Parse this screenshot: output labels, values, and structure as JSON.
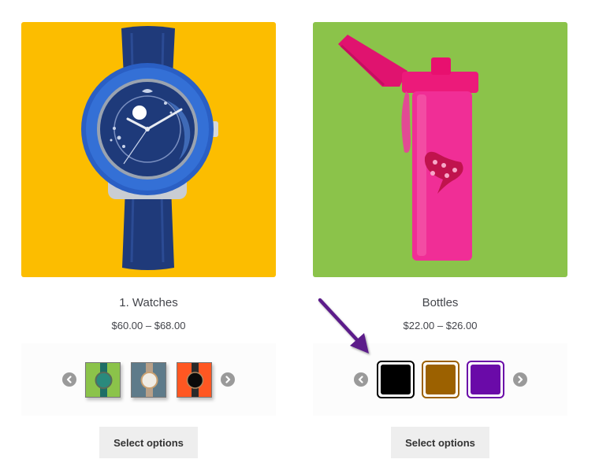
{
  "products": [
    {
      "title": "1. Watches",
      "price": "$60.00 – $68.00",
      "image": {
        "subject": "blue-watch-on-yellow",
        "background": "#fcbd00"
      },
      "swatch_type": "image",
      "swatches": [
        {
          "label": "green-watch",
          "background": "#8bc34a",
          "strap": "#1e6e66",
          "face": "#2a8a7d"
        },
        {
          "label": "silver-gold-watch",
          "background": "#5e7b8a",
          "strap": "#c0a080",
          "face": "#f0ece4"
        },
        {
          "label": "black-watch",
          "background": "#ff5722",
          "strap": "#2a2a2a",
          "face": "#0a0a0a"
        }
      ],
      "button_label": "Select options"
    },
    {
      "title": "Bottles",
      "price": "$22.00 – $26.00",
      "image": {
        "subject": "pink-water-bottle-on-green",
        "background": "#8bc34a"
      },
      "swatch_type": "color",
      "swatches": [
        {
          "label": "black",
          "color": "#000000"
        },
        {
          "label": "brown",
          "color": "#9c6100"
        },
        {
          "label": "purple",
          "color": "#6a0aa8"
        }
      ],
      "button_label": "Select options"
    }
  ],
  "annotation": {
    "type": "arrow",
    "color": "#5b1f8a",
    "points_to": "bottles-color-swatches"
  },
  "icons": {
    "prev": "chevron-left-icon",
    "next": "chevron-right-icon"
  }
}
